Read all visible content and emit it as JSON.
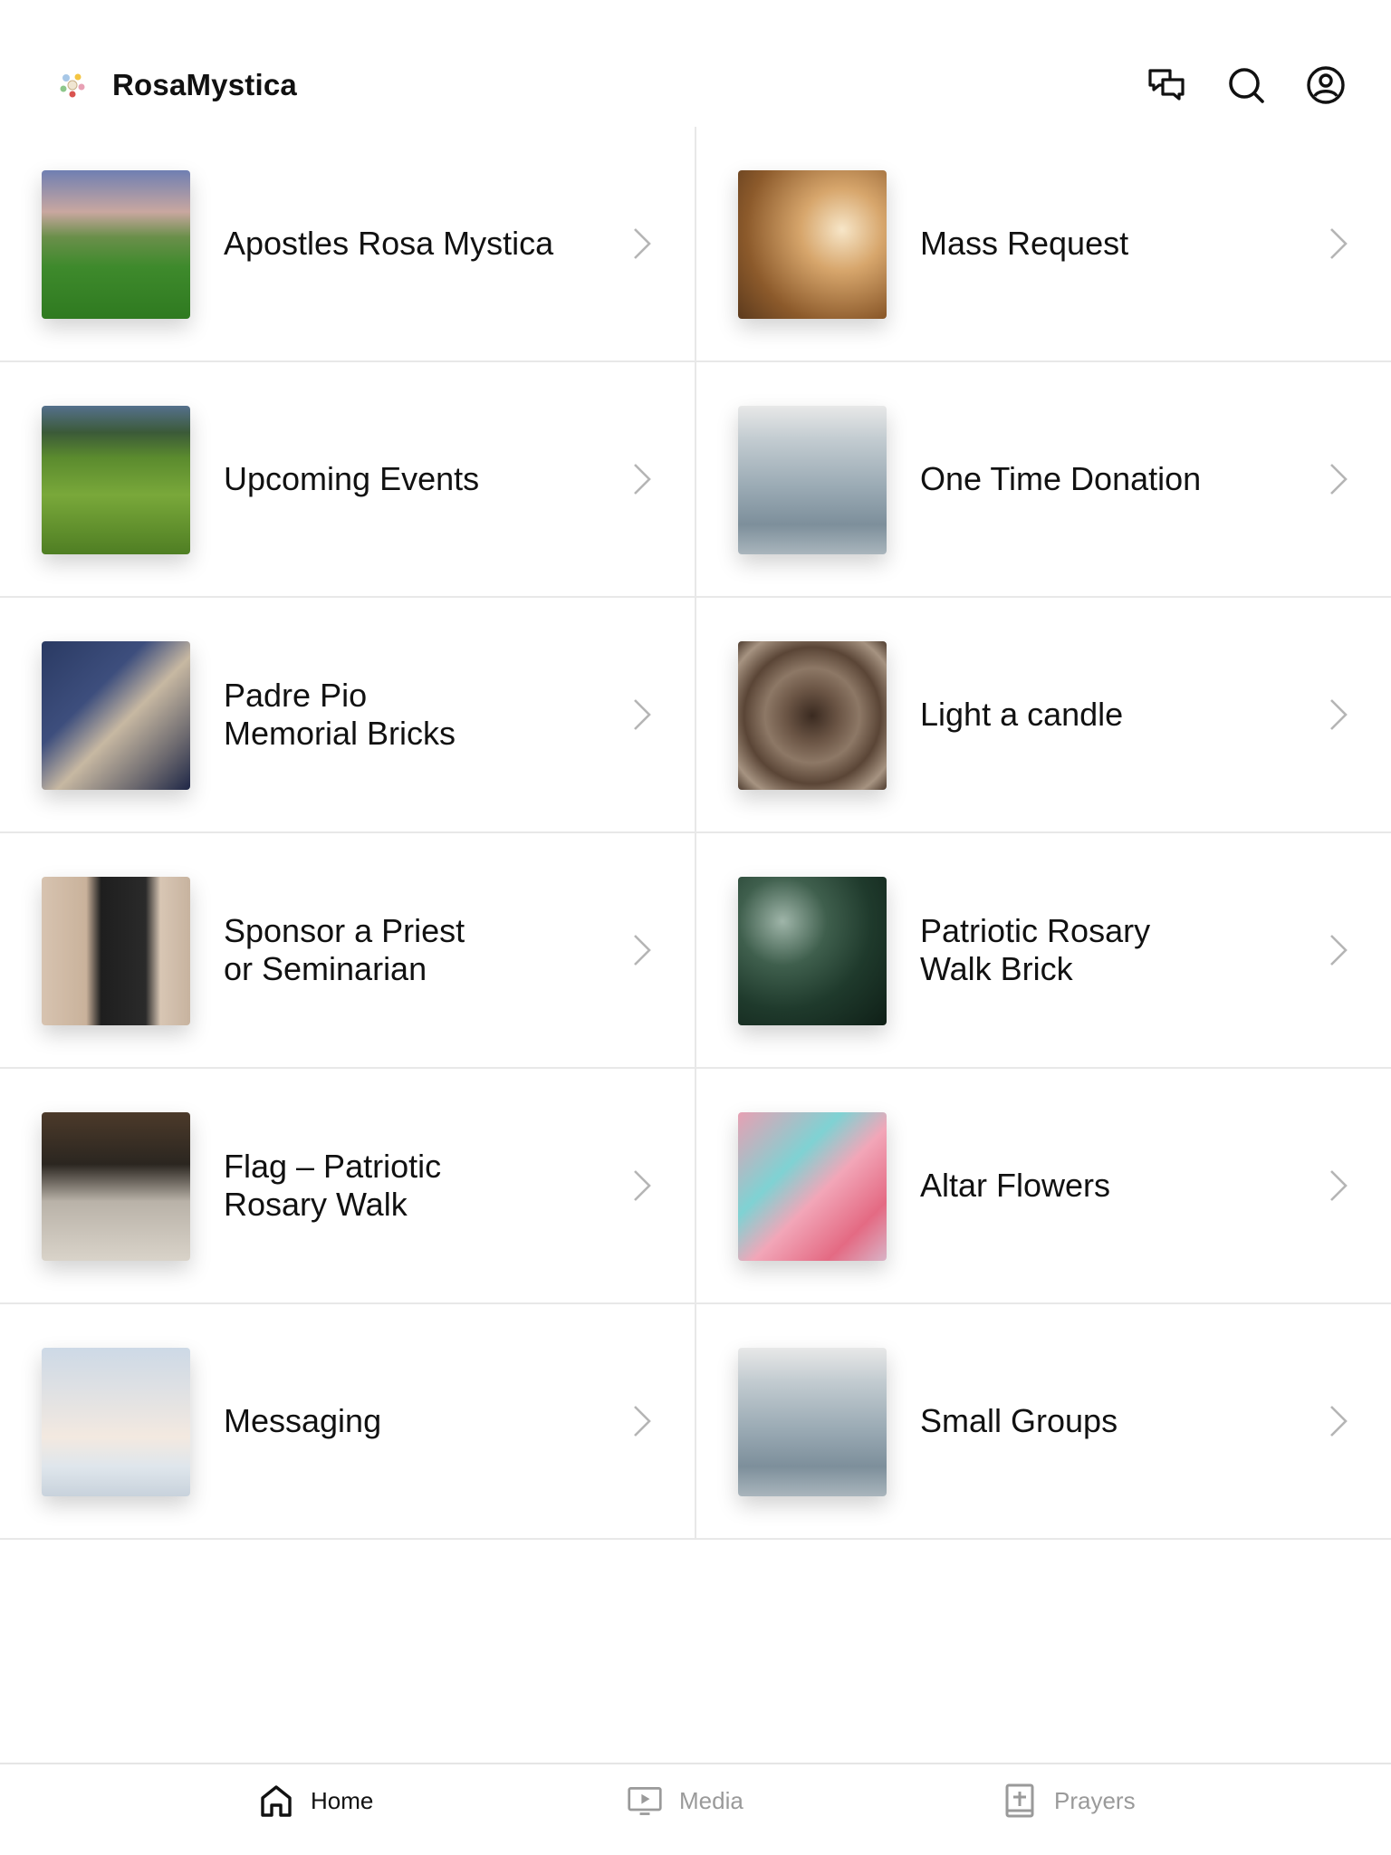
{
  "header": {
    "title": "RosaMystica",
    "logo_icon": "rosa-mystica-logo-icon",
    "actions": [
      {
        "name": "chat-icon"
      },
      {
        "name": "search-icon"
      },
      {
        "name": "account-icon"
      }
    ]
  },
  "items": [
    {
      "label": "Apostles Rosa Mystica",
      "image": "park-bench-walkway"
    },
    {
      "label": "Mass Request",
      "image": "chalice-and-book"
    },
    {
      "label": "Upcoming Events",
      "image": "green-fields"
    },
    {
      "label": "One Time Donation",
      "image": "man-on-mountain"
    },
    {
      "label": "Padre Pio\nMemorial Bricks",
      "image": "open-bible"
    },
    {
      "label": "Light a candle",
      "image": "tree-rings"
    },
    {
      "label": "Sponsor a Priest\nor Seminarian",
      "image": "person-on-beach"
    },
    {
      "label": "Patriotic Rosary\nWalk Brick",
      "image": "green-leaves"
    },
    {
      "label": "Flag – Patriotic\nRosary Walk",
      "image": "camera-on-table"
    },
    {
      "label": "Altar Flowers",
      "image": "pink-fluid-art"
    },
    {
      "label": "Messaging",
      "image": "sky-clouds"
    },
    {
      "label": "Small Groups",
      "image": "man-on-mountain"
    }
  ],
  "tabs": [
    {
      "label": "Home",
      "icon": "home-icon",
      "active": true
    },
    {
      "label": "Media",
      "icon": "media-icon",
      "active": false
    },
    {
      "label": "Prayers",
      "icon": "prayers-icon",
      "active": false
    }
  ],
  "colors": {
    "text": "#111111",
    "inactive_tab": "#9a9a9a",
    "divider": "#e8e8e8",
    "chevron": "#b5b5b5"
  }
}
